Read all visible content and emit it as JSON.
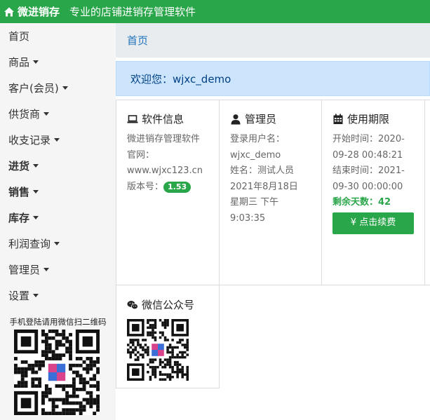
{
  "topbar": {
    "brand": "微进销存",
    "slogan": "专业的店铺进销存管理软件",
    "icon": "home-icon"
  },
  "sidebar": {
    "items": [
      {
        "label": "首页",
        "caret": false,
        "bold": false
      },
      {
        "label": "商品",
        "caret": true,
        "bold": false
      },
      {
        "label": "客户(会员)",
        "caret": true,
        "bold": false
      },
      {
        "label": "供货商",
        "caret": true,
        "bold": false
      },
      {
        "label": "收支记录",
        "caret": true,
        "bold": false
      },
      {
        "label": "进货",
        "caret": true,
        "bold": true
      },
      {
        "label": "销售",
        "caret": true,
        "bold": true
      },
      {
        "label": "库存",
        "caret": true,
        "bold": true
      },
      {
        "label": "利润查询",
        "caret": true,
        "bold": false
      },
      {
        "label": "管理员",
        "caret": true,
        "bold": false
      },
      {
        "label": "设置",
        "caret": true,
        "bold": false
      }
    ],
    "qr_caption": "手机登陆请用微信扫二维码"
  },
  "breadcrumb": {
    "home": "首页"
  },
  "welcome": {
    "text": "欢迎您：wjxc_demo"
  },
  "cards": {
    "software": {
      "title": "软件信息",
      "icon": "laptop-icon",
      "name": "微进销存管理软件",
      "site_label": "官网：",
      "site": "www.wjxc123.cn",
      "version_label": "版本号：",
      "version": "1.53"
    },
    "admin": {
      "title": "管理员",
      "icon": "user-icon",
      "login_label": "登录用户名：",
      "login": "wjxc_demo",
      "name_line": "姓名：测试人员",
      "date": "2021年8月18日",
      "weekday_time": "星期三 下午",
      "time": "9:03:35"
    },
    "period": {
      "title": "使用期限",
      "icon": "calendar-icon",
      "start_line1": "开始时间：2020-",
      "start_line2": "09-28 00:48:21",
      "end_line1": "结束时间：2021-",
      "end_line2": "09-30 00:00:00",
      "remaining": "剩余天数：42",
      "renew": "¥ 点击续费"
    },
    "wechat": {
      "title": "微信公众号",
      "icon": "wechat-icon"
    }
  },
  "colors": {
    "brand_green": "#2aa64a",
    "link_blue": "#1e73be",
    "alert_blue": "#cce5fd"
  }
}
